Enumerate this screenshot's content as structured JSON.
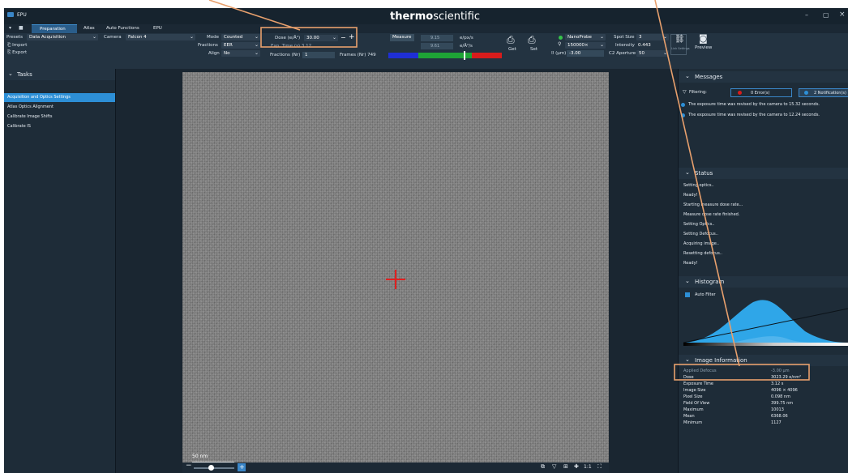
{
  "app": {
    "title": "EPU",
    "brand_bold": "thermo",
    "brand_light": "scientific",
    "maximize_glyph": "▢",
    "close_glyph": "×",
    "minimize_glyph": "–"
  },
  "tabs": [
    {
      "label": "Preparation",
      "active": true
    },
    {
      "label": "Atlas",
      "active": false
    },
    {
      "label": "Auto Functions",
      "active": false
    },
    {
      "label": "EPU",
      "active": false
    }
  ],
  "preset": {
    "label": "Presets",
    "value": "Data Acquisition",
    "import": "Import",
    "export": "Export",
    "group": "Preset Selection"
  },
  "camera": {
    "label": "Camera",
    "value": "Falcon 4",
    "group": "Camera Settings"
  },
  "mode": {
    "label": "Mode",
    "value": "Counted",
    "fractions_label": "Fractions",
    "fractions_value": "EER",
    "align_label": "Align",
    "align_value": "No"
  },
  "exposure": {
    "dose_label": "Dose (e/Å²)",
    "dose_value": "30.00",
    "exp_label": "Exp. Time (s)",
    "exp_value": "3.12",
    "fractions_nr_label": "Fractions (Nr)",
    "fractions_nr_value": "1",
    "frames_label": "Frames (Nr)",
    "frames_value": "749",
    "group": "Exposure Settings",
    "minus": "−",
    "plus": "+"
  },
  "dose_rate": {
    "measure_label": "Measure",
    "value1": "9.15",
    "unit1": "e/px/s",
    "value2": "9.61",
    "unit2": "e/Å²/s",
    "group": "Dose Rate",
    "bar_colors": [
      "#1f2fd6",
      "#1ea436",
      "#d81c1c"
    ]
  },
  "get_set": {
    "get": "Get",
    "set": "Set"
  },
  "optics": {
    "probe": "NanoProbe",
    "mag": "150000×",
    "defocus_label": "(µm)",
    "defocus_value": "-3.00",
    "spot_label": "Spot Size",
    "spot_value": "3",
    "intensity_label": "Intensity",
    "intensity_value": "0.443",
    "aperture_label": "C2 Aperture",
    "aperture_value": "50",
    "group": "Optics Settings",
    "link_label": "Link Settings",
    "status_color": "#36c24a"
  },
  "acquisition": {
    "preview": "Preview",
    "group": "Acquisition"
  },
  "tasks": {
    "title": "Tasks",
    "items": [
      {
        "label": "Acquisition and Optics Settings",
        "active": true
      },
      {
        "label": "Atlas Optics Alignment",
        "active": false
      },
      {
        "label": "Calibrate Image Shifts",
        "active": false
      },
      {
        "label": "Calibrate IS",
        "active": false
      }
    ]
  },
  "image_view": {
    "scale_label": "50 nm",
    "zoom_label": "1:1"
  },
  "messages": {
    "title": "Messages",
    "filter_label": "Filtering:",
    "errors": "0 Error(s)",
    "notifications": "2 Notification(s)",
    "items": [
      "The exposure time was revised by the camera to 15.32 seconds.",
      "The exposure time was revised by the camera to 12.24 seconds."
    ]
  },
  "status": {
    "title": "Status",
    "lines": [
      "Setting optics..",
      "Ready!",
      "Starting measure dose rate...",
      "Measure dose rate finished.",
      "Setting Optics..",
      "Setting Defocus..",
      "Acquiring image..",
      "Resetting defocus..",
      "Ready!"
    ]
  },
  "histogram": {
    "title": "Histogram",
    "auto_filter": "Auto Filter",
    "auto_filter_checked": true
  },
  "image_information": {
    "title": "Image Information",
    "rows": [
      {
        "key": "Applied Defocus",
        "value": "-3.00 µm"
      },
      {
        "key": "Dose",
        "value": "3023.29 e/nm²"
      },
      {
        "key": "Exposure Time",
        "value": "3.12 s"
      },
      {
        "key": "Image Size",
        "value": "4096 × 4096"
      },
      {
        "key": "Pixel Size",
        "value": "0.098 nm"
      },
      {
        "key": "Field Of View",
        "value": "399.75 nm"
      },
      {
        "key": "Maximum",
        "value": "10013"
      },
      {
        "key": "Mean",
        "value": "6368.06"
      },
      {
        "key": "Minimum",
        "value": "1127"
      }
    ]
  },
  "colors": {
    "accent": "#2d8fd6",
    "highlight": "#e8a06d",
    "crosshair": "#e12020"
  }
}
